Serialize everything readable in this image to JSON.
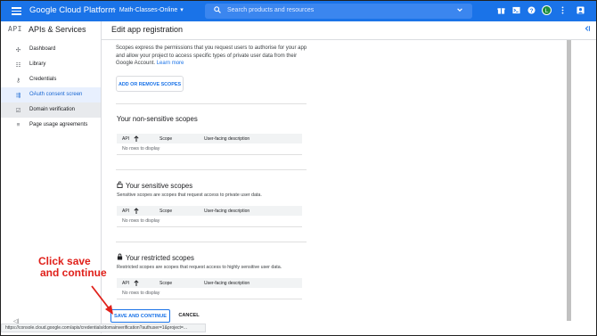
{
  "topbar": {
    "brand": "Google Cloud Platform",
    "project": "Math-Classes-Online",
    "project_chevron": "▾",
    "search_placeholder": "Search products and resources",
    "search_icon": "search-icon",
    "avatar_letter": "L",
    "icons": [
      "gift-icon",
      "terminal-icon",
      "help-icon",
      "user-avatar",
      "more-vert-icon"
    ],
    "color": "#1a73e8"
  },
  "sidebar": {
    "api_badge": "API",
    "title": "APIs & Services",
    "items": [
      {
        "icon": "dashboard-icon",
        "glyph": "✣",
        "label": "Dashboard"
      },
      {
        "icon": "library-icon",
        "glyph": "☷",
        "label": "Library"
      },
      {
        "icon": "key-icon",
        "glyph": "⚷",
        "label": "Credentials"
      },
      {
        "icon": "consent-icon",
        "glyph": "⇶",
        "label": "OAuth consent screen"
      },
      {
        "icon": "check-box-icon",
        "glyph": "☑",
        "label": "Domain verification"
      },
      {
        "icon": "settings-icon",
        "glyph": "≡",
        "label": "Page usage agreements"
      }
    ],
    "collapse_glyph": "◁|"
  },
  "main": {
    "page_title": "Edit app registration",
    "description": "Scopes express the permissions that you request users to authorise for your app and allow your project to access specific types of private user data from their Google Account.",
    "learn_more": "Learn more",
    "add_remove_scopes": "ADD OR REMOVE SCOPES",
    "table_headers": {
      "api": "API",
      "scope": "Scope",
      "desc": "User-facing description"
    },
    "sort_arrow": "🡡",
    "empty_text": "No rows to display",
    "sections": [
      {
        "title": "Your non-sensitive scopes",
        "icon": "",
        "subtitle": ""
      },
      {
        "title": "Your sensitive scopes",
        "icon": "lock-open-icon",
        "subtitle": "Sensitive scopes are scopes that request access to private user data."
      },
      {
        "title": "Your restricted scopes",
        "icon": "lock-icon",
        "subtitle": "Restricted scopes are scopes that request access to highly sensitive user data."
      }
    ],
    "save_continue": "SAVE AND CONTINUE",
    "cancel": "CANCEL"
  },
  "status_url": "https://console.cloud.google.com/apis/credentials/domainverification?authuser=1&project=...",
  "annotation": {
    "line1": "Click save",
    "line2": "and continue",
    "color": "#e0211b"
  }
}
